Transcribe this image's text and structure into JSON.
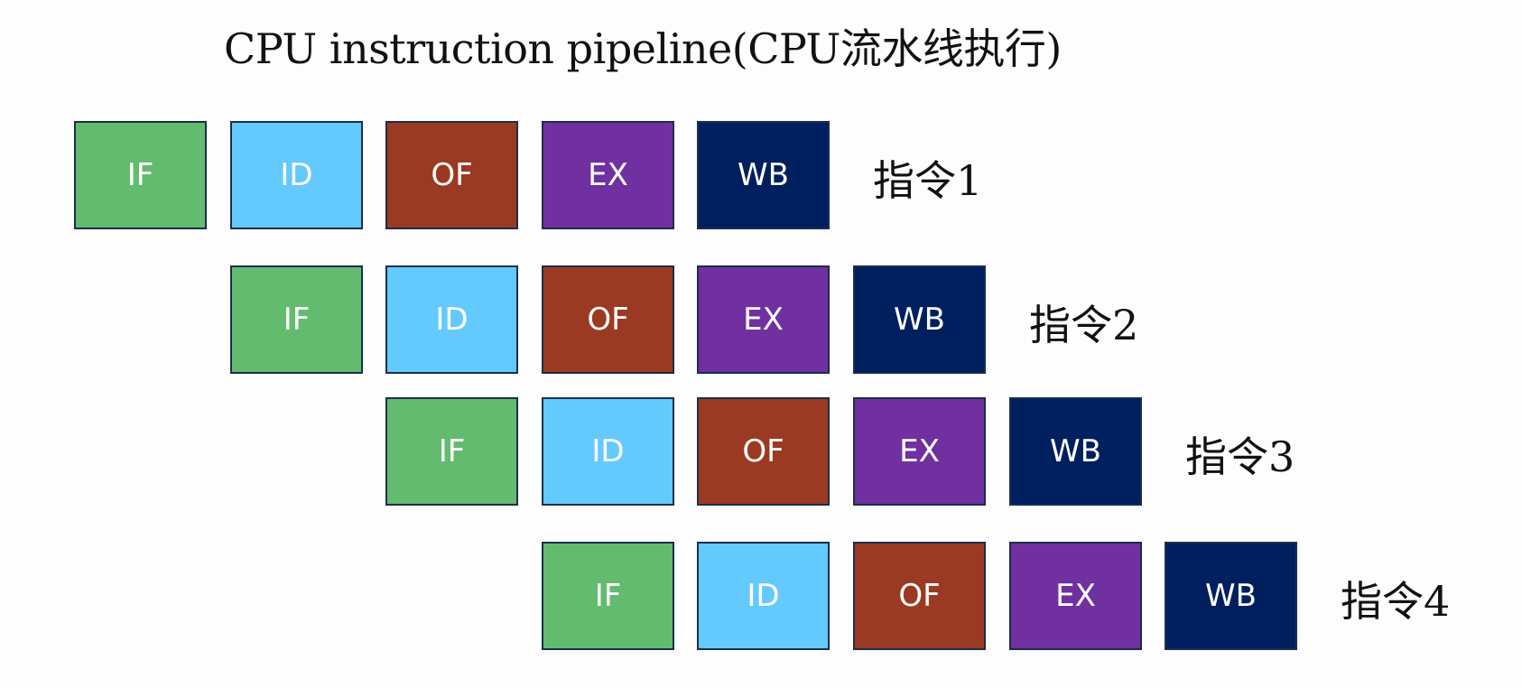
{
  "title": "CPU instruction pipeline(CPU流水线执行)",
  "stages": [
    {
      "label": "IF",
      "color": "#63bb6f"
    },
    {
      "label": "ID",
      "color": "#64c9fd"
    },
    {
      "label": "OF",
      "color": "#9b3a22"
    },
    {
      "label": "EX",
      "color": "#7030a0"
    },
    {
      "label": "WB",
      "color": "#001f5f"
    }
  ],
  "instructions": [
    {
      "label": "指令1"
    },
    {
      "label": "指令2"
    },
    {
      "label": "指令3"
    },
    {
      "label": "指令4"
    }
  ]
}
